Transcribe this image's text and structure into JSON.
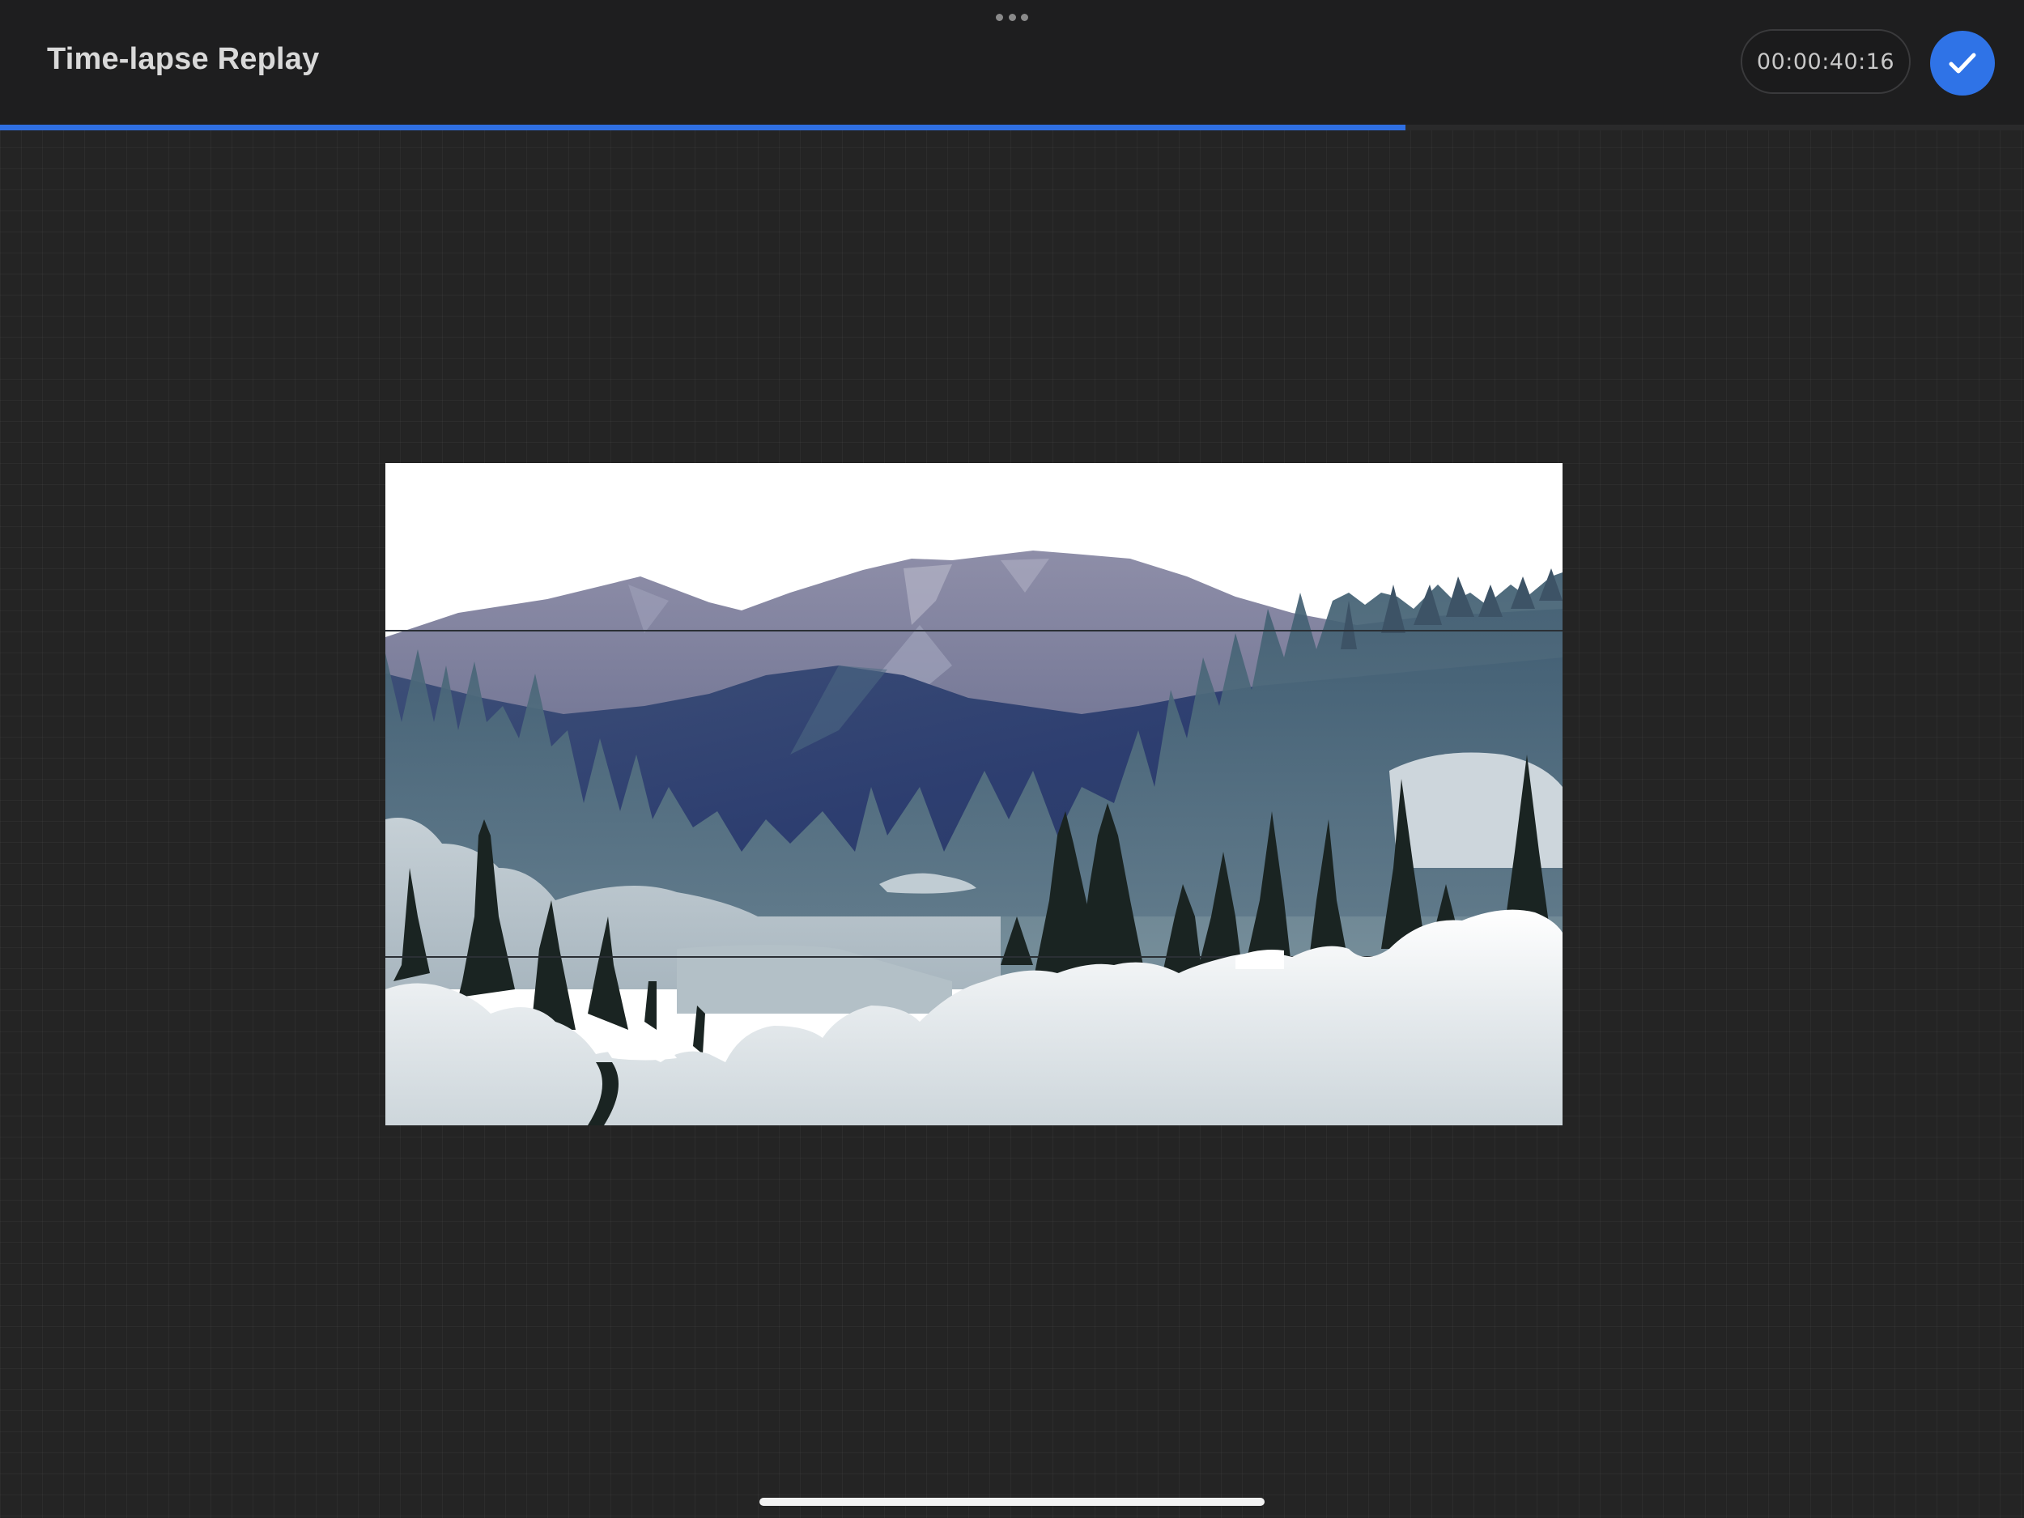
{
  "header": {
    "title": "Time-lapse Replay",
    "elapsed_time": "00:00:40:16",
    "grabber_icon": "more-dots-icon",
    "done_icon": "checkmark-icon"
  },
  "playback": {
    "progress_fraction": 0.6944
  },
  "artwork": {
    "subject_icon": "winter-mountain-landscape-illustration"
  },
  "colors": {
    "accent": "#2f73e7",
    "background": "#242424",
    "topbar": "#1e1e1f"
  }
}
